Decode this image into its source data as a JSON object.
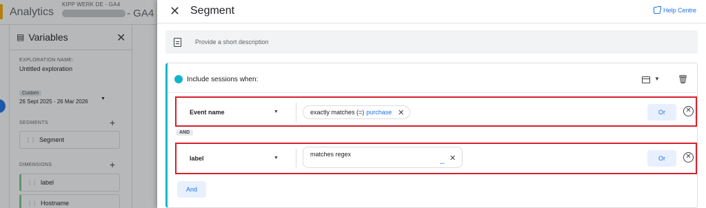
{
  "app": {
    "name": "Analytics",
    "account": "KIPP WERK DE - GA4",
    "property_suffix": "- GA4"
  },
  "variables_panel": {
    "title": "Variables",
    "exploration_label": "EXPLORATION NAME:",
    "exploration_name": "Untitled exploration",
    "date_chip": "Custom",
    "date_range": "26 Sept 2025 - 26 Mar 2026",
    "segments_label": "SEGMENTS",
    "segments": [
      "Segment"
    ],
    "dimensions_label": "DIMENSIONS",
    "dimensions": [
      "label",
      "Hostname"
    ]
  },
  "segment_dialog": {
    "title": "Segment",
    "help_label": "Help Centre",
    "description_placeholder": "Provide a short description",
    "condition_title": "Include sessions when:",
    "and_separator": "AND",
    "and_button": "And",
    "or_button": "Or",
    "filters": [
      {
        "dimension": "Event name",
        "operator": "exactly matches (=)",
        "value": "purchase"
      },
      {
        "dimension": "label",
        "operator": "matches regex",
        "value": "",
        "more_indicator": "..."
      }
    ]
  },
  "colors": {
    "accent": "#1a73e8",
    "segment_teal": "#12b5cb",
    "highlight_red": "#d61f2c"
  },
  "icons": {
    "close": "close-icon",
    "help": "open-in-new-icon",
    "description": "document-icon",
    "scope": "scope-icon",
    "delete": "trash-icon",
    "remove_filter": "remove-circle-icon"
  }
}
